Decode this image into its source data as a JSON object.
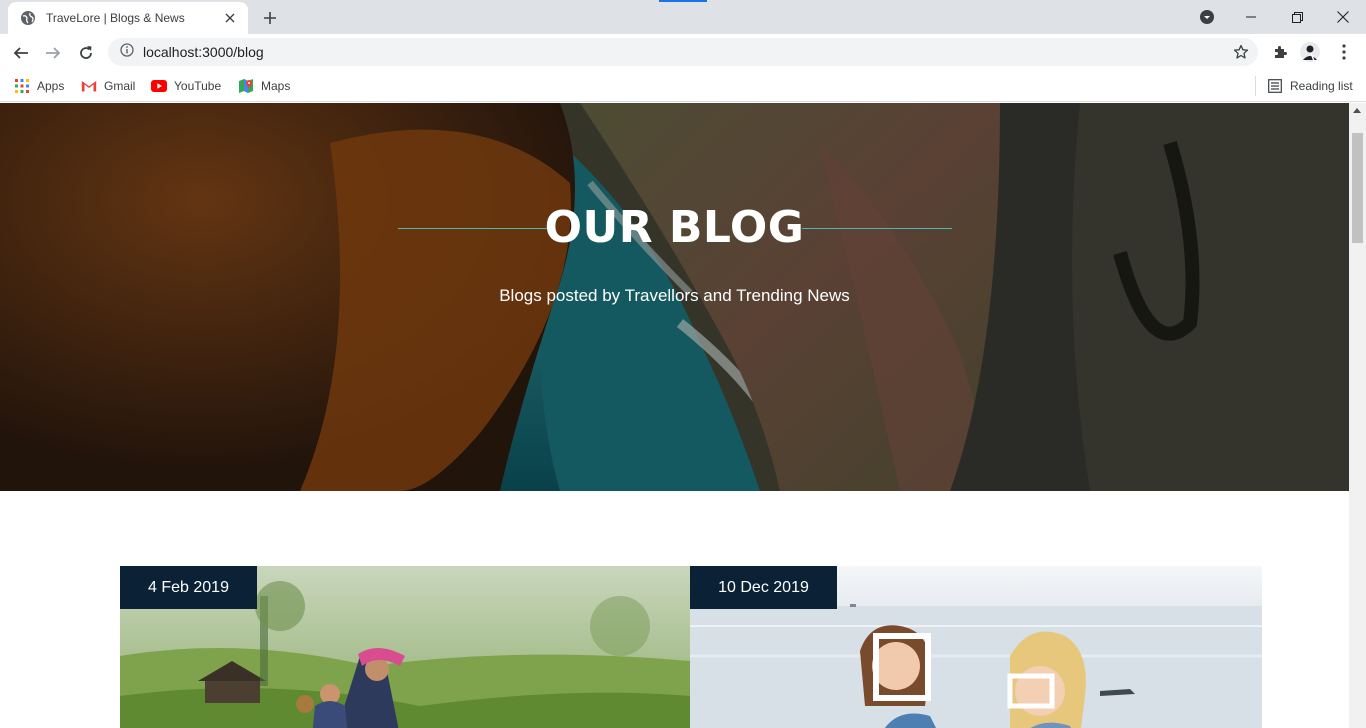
{
  "browser": {
    "tab_title": "TraveLore | Blogs & News",
    "url": "localhost:3000/blog",
    "bookmarks": [
      {
        "label": "Apps",
        "icon": "apps-grid-icon"
      },
      {
        "label": "Gmail",
        "icon": "gmail-icon"
      },
      {
        "label": "YouTube",
        "icon": "youtube-icon"
      },
      {
        "label": "Maps",
        "icon": "maps-icon"
      }
    ],
    "reading_list": "Reading list"
  },
  "hero": {
    "title": "OUR BLOG",
    "subtitle": "Blogs posted by Travellors and Trending News",
    "accent_color": "#4fb7b3"
  },
  "posts": [
    {
      "date": "4 Feb 2019"
    },
    {
      "date": "10 Dec 2019"
    }
  ],
  "colors": {
    "date_badge_bg": "#0b2236"
  }
}
